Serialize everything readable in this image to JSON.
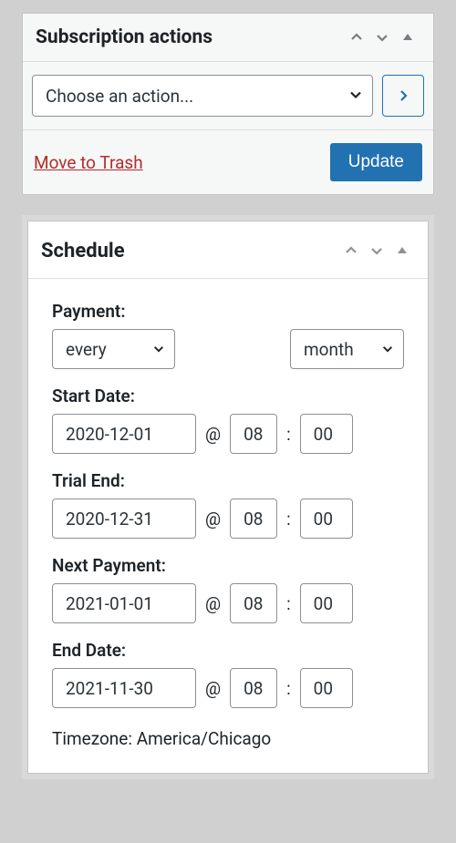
{
  "actions_panel": {
    "title": "Subscription actions",
    "placeholder": "Choose an action...",
    "trash": "Move to Trash",
    "update": "Update"
  },
  "schedule_panel": {
    "title": "Schedule",
    "payment_label": "Payment:",
    "payment_every": "every",
    "payment_unit": "month",
    "start_label": "Start Date:",
    "trial_label": "Trial End:",
    "next_label": "Next Payment:",
    "end_label": "End Date:",
    "start": {
      "date": "2020-12-01",
      "h": "08",
      "m": "00"
    },
    "trial": {
      "date": "2020-12-31",
      "h": "08",
      "m": "00"
    },
    "next": {
      "date": "2021-01-01",
      "h": "08",
      "m": "00"
    },
    "end": {
      "date": "2021-11-30",
      "h": "08",
      "m": "00"
    },
    "timezone": "Timezone: America/Chicago"
  },
  "sym": {
    "at": "@",
    "colon": ":"
  }
}
